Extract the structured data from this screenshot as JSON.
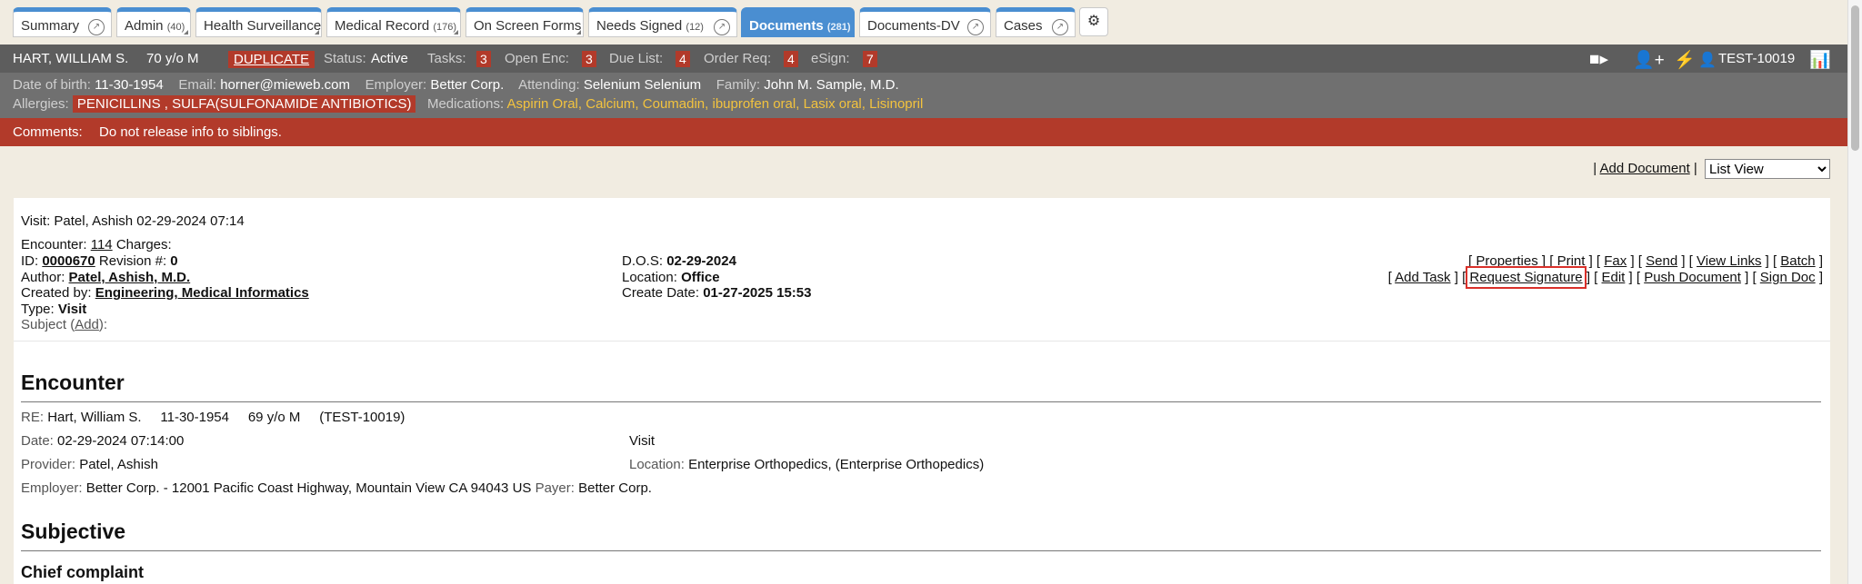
{
  "tabs": [
    {
      "label": "Summary",
      "count": ""
    },
    {
      "label": "Admin",
      "count": "(40)"
    },
    {
      "label": "Health Surveillance",
      "count": ""
    },
    {
      "label": "Medical Record",
      "count": "(176)"
    },
    {
      "label": "On Screen Forms",
      "count": ""
    },
    {
      "label": "Needs Signed",
      "count": "(12)"
    },
    {
      "label": "Documents",
      "count": "(281)"
    },
    {
      "label": "Documents-DV",
      "count": ""
    },
    {
      "label": "Cases",
      "count": ""
    }
  ],
  "icons": {
    "tab_link": "arrow-circle-icon",
    "settings": "gears-icon",
    "video": "video-camera-icon",
    "add_user": "user-plus-icon",
    "flash": "bolt-icon",
    "user": "user-icon",
    "chart": "bar-chart-icon"
  },
  "patient": {
    "name": "HART, WILLIAM S.",
    "age_sex": "70 y/o M",
    "duplicate": "DUPLICATE",
    "status_label": "Status:",
    "status": "Active",
    "tasks_label": "Tasks:",
    "tasks": "3",
    "open_enc_label": "Open Enc:",
    "open_enc": "3",
    "due_list_label": "Due List:",
    "due_list": "4",
    "order_req_label": "Order Req:",
    "order_req": "4",
    "esign_label": "eSign:",
    "esign": "7",
    "id": "TEST-10019",
    "dob_label": "Date of birth:",
    "dob": "11-30-1954",
    "email_label": "Email:",
    "email": "horner@mieweb.com",
    "employer_label": "Employer:",
    "employer": "Better Corp.",
    "attending_label": "Attending:",
    "attending": "Selenium Selenium",
    "family_label": "Family:",
    "family": "John M. Sample, M.D.",
    "allergies_label": "Allergies:",
    "allergies": "PENICILLINS , SULFA(SULFONAMIDE ANTIBIOTICS)",
    "medications_label": "Medications:",
    "medications": [
      "Aspirin Oral",
      "Calcium",
      "Coumadin",
      "ibuprofen oral",
      "Lasix oral",
      "Lisinopril"
    ],
    "comments_label": "Comments:",
    "comments": "Do not release info to siblings."
  },
  "toolbar": {
    "sep": "|",
    "add_document": "Add Document",
    "view_selected": "List View"
  },
  "doc": {
    "visit_line": "Visit: Patel, Ashish 02-29-2024 07:14",
    "encounter_label": "Encounter:",
    "encounter": "114",
    "charges_label": "Charges:",
    "id_label": "ID:",
    "id": "0000670",
    "revision_label": "Revision #:",
    "revision": "0",
    "author_label": "Author:",
    "author": "Patel, Ashish, M.D.",
    "created_label": "Created by:",
    "created_by": "Engineering, Medical Informatics",
    "type_label": "Type:",
    "type": "Visit",
    "subject_label": "Subject (",
    "subject_add": "Add",
    "subject_end": "):",
    "dos_label": "D.O.S:",
    "dos": "02-29-2024",
    "location_label": "Location:",
    "location": "Office",
    "create_date_label": "Create Date:",
    "create_date": "01-27-2025 15:53",
    "actions_row1": [
      "Properties",
      "Print",
      "Fax",
      "Send",
      "View Links",
      "Batch"
    ],
    "actions_row2": [
      "Add Task",
      "Request Signature",
      "Edit",
      "Push Document",
      "Sign Doc"
    ]
  },
  "encounter": {
    "heading": "Encounter",
    "re_label": "RE:",
    "re": "Hart, William S.",
    "re_dob": "11-30-1954",
    "re_age": "69 y/o M",
    "re_id": "(TEST-10019)",
    "date_label": "Date:",
    "date": "02-29-2024 07:14:00",
    "visit": "Visit",
    "provider_label": "Provider:",
    "provider": "Patel, Ashish",
    "location_label": "Location:",
    "location": "Enterprise Orthopedics, (Enterprise Orthopedics)",
    "employer_label": "Employer:",
    "employer": "Better Corp. - 12001 Pacific Coast Highway, Mountain View CA 94043 US",
    "payer_label": "Payer:",
    "payer": "Better Corp."
  },
  "subjective": {
    "heading": "Subjective",
    "chief_complaint": "Chief complaint"
  }
}
